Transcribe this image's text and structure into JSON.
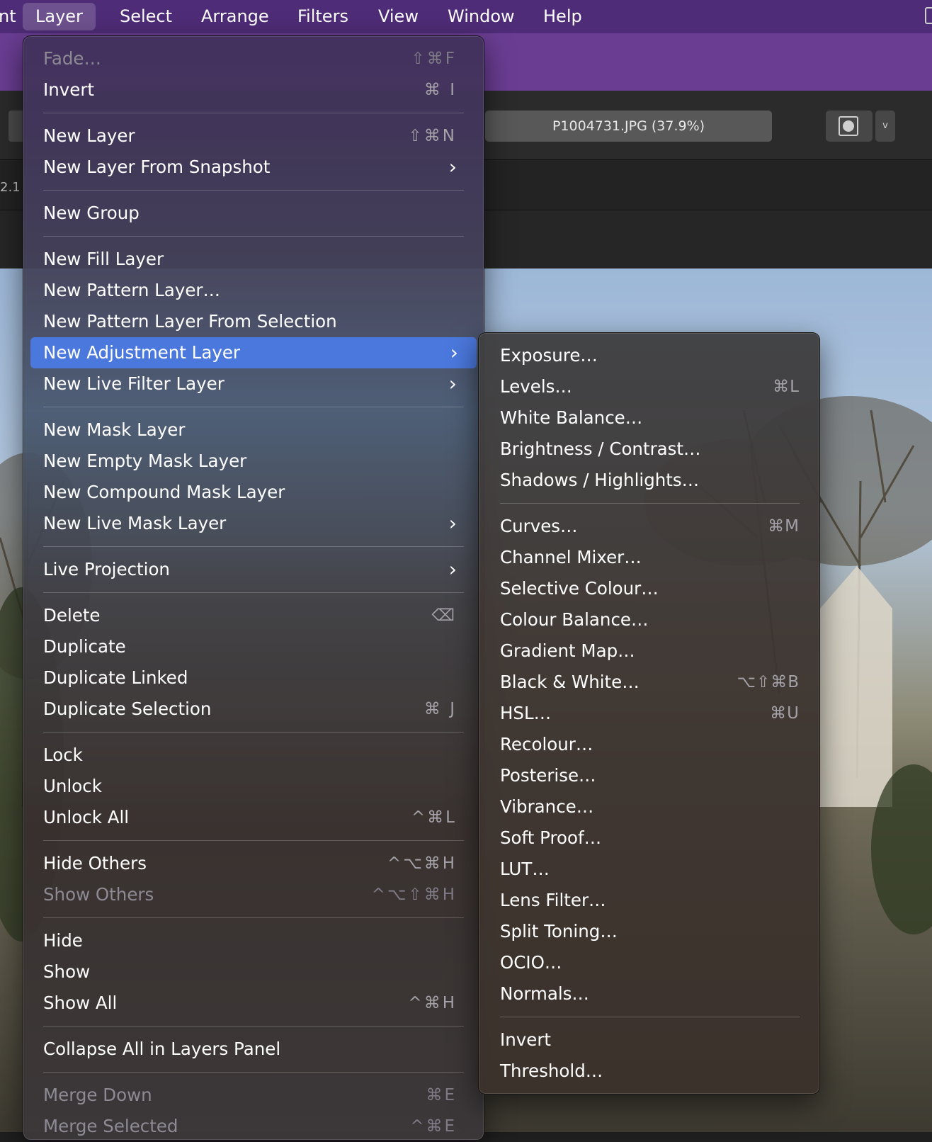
{
  "menubar": {
    "items": [
      {
        "label": "nt"
      },
      {
        "label": "Layer"
      },
      {
        "label": "Select"
      },
      {
        "label": "Arrange"
      },
      {
        "label": "Filters"
      },
      {
        "label": "View"
      },
      {
        "label": "Window"
      },
      {
        "label": "Help"
      }
    ],
    "active": "Layer"
  },
  "toolbar": {
    "document_title": "P1004731.JPG (37.9%)",
    "view_dropdown_chevron": "v",
    "left_fragment": "2.1"
  },
  "layer_menu": {
    "items": {
      "fade": {
        "label": "Fade…",
        "shortcut": "⇧⌘F",
        "disabled": true
      },
      "invert": {
        "label": "Invert",
        "shortcut": "⌘ I"
      },
      "new_layer": {
        "label": "New Layer",
        "shortcut": "⇧⌘N"
      },
      "new_layer_from_snapshot": {
        "label": "New Layer From Snapshot",
        "submenu": true
      },
      "new_group": {
        "label": "New Group"
      },
      "new_fill_layer": {
        "label": "New Fill Layer"
      },
      "new_pattern_layer": {
        "label": "New Pattern Layer…"
      },
      "new_pattern_layer_from_selection": {
        "label": "New Pattern Layer From Selection"
      },
      "new_adjustment_layer": {
        "label": "New Adjustment Layer",
        "submenu": true,
        "highlighted": true
      },
      "new_live_filter_layer": {
        "label": "New Live Filter Layer",
        "submenu": true
      },
      "new_mask_layer": {
        "label": "New Mask Layer"
      },
      "new_empty_mask_layer": {
        "label": "New Empty Mask Layer"
      },
      "new_compound_mask_layer": {
        "label": "New Compound Mask Layer"
      },
      "new_live_mask_layer": {
        "label": "New Live Mask Layer",
        "submenu": true
      },
      "live_projection": {
        "label": "Live Projection",
        "submenu": true
      },
      "delete": {
        "label": "Delete",
        "shortcut": "⌫"
      },
      "duplicate": {
        "label": "Duplicate"
      },
      "duplicate_linked": {
        "label": "Duplicate Linked"
      },
      "duplicate_selection": {
        "label": "Duplicate Selection",
        "shortcut": "⌘ J"
      },
      "lock": {
        "label": "Lock"
      },
      "unlock": {
        "label": "Unlock"
      },
      "unlock_all": {
        "label": "Unlock All",
        "shortcut": "^⌘L"
      },
      "hide_others": {
        "label": "Hide Others",
        "shortcut": "^⌥⌘H"
      },
      "show_others": {
        "label": "Show Others",
        "shortcut": "^⌥⇧⌘H",
        "disabled": true
      },
      "hide": {
        "label": "Hide"
      },
      "show": {
        "label": "Show"
      },
      "show_all": {
        "label": "Show All",
        "shortcut": "^⌘H"
      },
      "collapse_all": {
        "label": "Collapse All in Layers Panel"
      },
      "merge_down": {
        "label": "Merge Down",
        "shortcut": "⌘E",
        "disabled": true
      },
      "merge_selected": {
        "label": "Merge Selected",
        "shortcut": "^⌘E",
        "disabled": true
      }
    }
  },
  "adjustment_submenu": {
    "items": {
      "exposure": {
        "label": "Exposure…"
      },
      "levels": {
        "label": "Levels…",
        "shortcut": "⌘L"
      },
      "white_balance": {
        "label": "White Balance…"
      },
      "brightness_contrast": {
        "label": "Brightness / Contrast…"
      },
      "shadows_highlights": {
        "label": "Shadows / Highlights…"
      },
      "curves": {
        "label": "Curves…",
        "shortcut": "⌘M"
      },
      "channel_mixer": {
        "label": "Channel Mixer…"
      },
      "selective_colour": {
        "label": "Selective Colour…"
      },
      "colour_balance": {
        "label": "Colour Balance…"
      },
      "gradient_map": {
        "label": "Gradient Map…"
      },
      "black_white": {
        "label": "Black & White…",
        "shortcut": "⌥⇧⌘B"
      },
      "hsl": {
        "label": "HSL…",
        "shortcut": "⌘U"
      },
      "recolour": {
        "label": "Recolour…"
      },
      "posterise": {
        "label": "Posterise…"
      },
      "vibrance": {
        "label": "Vibrance…"
      },
      "soft_proof": {
        "label": "Soft Proof…"
      },
      "lut": {
        "label": "LUT…"
      },
      "lens_filter": {
        "label": "Lens Filter…"
      },
      "split_toning": {
        "label": "Split Toning…"
      },
      "ocio": {
        "label": "OCIO…"
      },
      "normals": {
        "label": "Normals…"
      },
      "invert": {
        "label": "Invert"
      },
      "threshold": {
        "label": "Threshold…"
      }
    }
  },
  "icons": {
    "submenu_chevron": "›",
    "view_mode": "circle-in-square-icon",
    "window_edge": "window-icon"
  },
  "colors": {
    "menubar": "#4f2c77",
    "highlight": "#4b78dc",
    "toolbar_purple": "#6a3d93"
  }
}
